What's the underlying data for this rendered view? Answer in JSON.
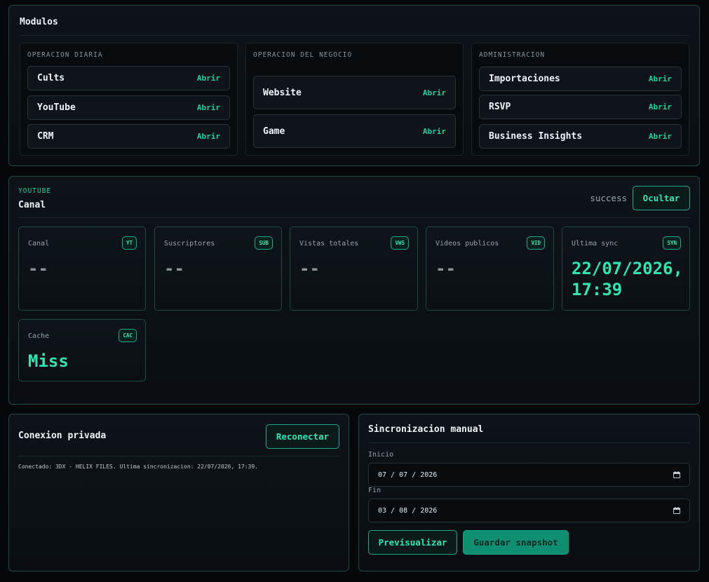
{
  "modules": {
    "title": "Modulos",
    "open_label": "Abrir",
    "groups": [
      {
        "label": "OPERACION DIARIA",
        "items": [
          "Cults",
          "YouTube",
          "CRM"
        ]
      },
      {
        "label": "OPERACION DEL NEGOCIO",
        "items": [
          "Website",
          "Game"
        ]
      },
      {
        "label": "ADMINISTRACION",
        "items": [
          "Importaciones",
          "RSVP",
          "Business Insights"
        ]
      }
    ]
  },
  "youtube": {
    "eyebrow": "YOUTUBE",
    "title": "Canal",
    "status": "success",
    "hide_label": "Ocultar",
    "stats": [
      {
        "label": "Canal",
        "badge": "YT",
        "value": "--"
      },
      {
        "label": "Suscriptores",
        "badge": "SUB",
        "value": "--"
      },
      {
        "label": "Vistas totales",
        "badge": "VWS",
        "value": "--"
      },
      {
        "label": "Videos publicos",
        "badge": "VID",
        "value": "--"
      },
      {
        "label": "Ultima sync",
        "badge": "SYN",
        "value": "22/07/2026, 17:39"
      },
      {
        "label": "Cache",
        "badge": "CAC",
        "value": "Miss"
      }
    ]
  },
  "connection": {
    "title": "Conexion privada",
    "reconnect_label": "Reconectar",
    "message": "Conectado: 3DX - HELIX FILES. Ultima sincronizacion: 22/07/2026, 17:39."
  },
  "manual_sync": {
    "title": "Sincronizacion manual",
    "start_label": "Inicio",
    "start_value": "07 / 07 / 2026",
    "end_label": "Fin",
    "end_value": "03 / 08 / 2026",
    "preview_label": "Previsualizar",
    "save_label": "Guardar snapshot"
  },
  "colors": {
    "accent": "#19d3a2",
    "border": "#1f4a40",
    "background": "#05070a"
  }
}
